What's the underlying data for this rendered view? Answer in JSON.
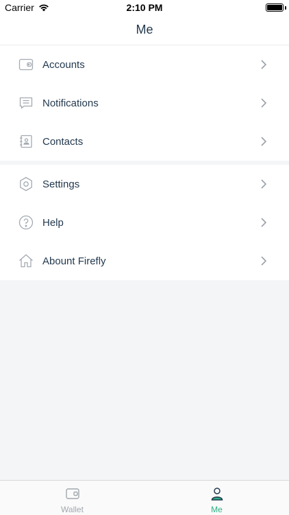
{
  "status_bar": {
    "carrier": "Carrier",
    "time": "2:10 PM"
  },
  "nav": {
    "title": "Me"
  },
  "groups": [
    {
      "items": [
        {
          "label": "Accounts",
          "icon": "wallet-icon"
        },
        {
          "label": "Notifications",
          "icon": "message-icon"
        },
        {
          "label": "Contacts",
          "icon": "contact-card-icon"
        }
      ]
    },
    {
      "items": [
        {
          "label": "Settings",
          "icon": "gear-icon"
        },
        {
          "label": "Help",
          "icon": "help-icon"
        },
        {
          "label": "Abount Firefly",
          "icon": "home-icon"
        }
      ]
    }
  ],
  "tab_bar": {
    "tabs": [
      {
        "label": "Wallet",
        "icon": "wallet-icon",
        "active": false
      },
      {
        "label": "Me",
        "icon": "person-icon",
        "active": true
      }
    ]
  },
  "colors": {
    "text": "#23394e",
    "accent": "#2db083",
    "inactive": "#a0a7ad",
    "background": "#f4f5f7"
  }
}
